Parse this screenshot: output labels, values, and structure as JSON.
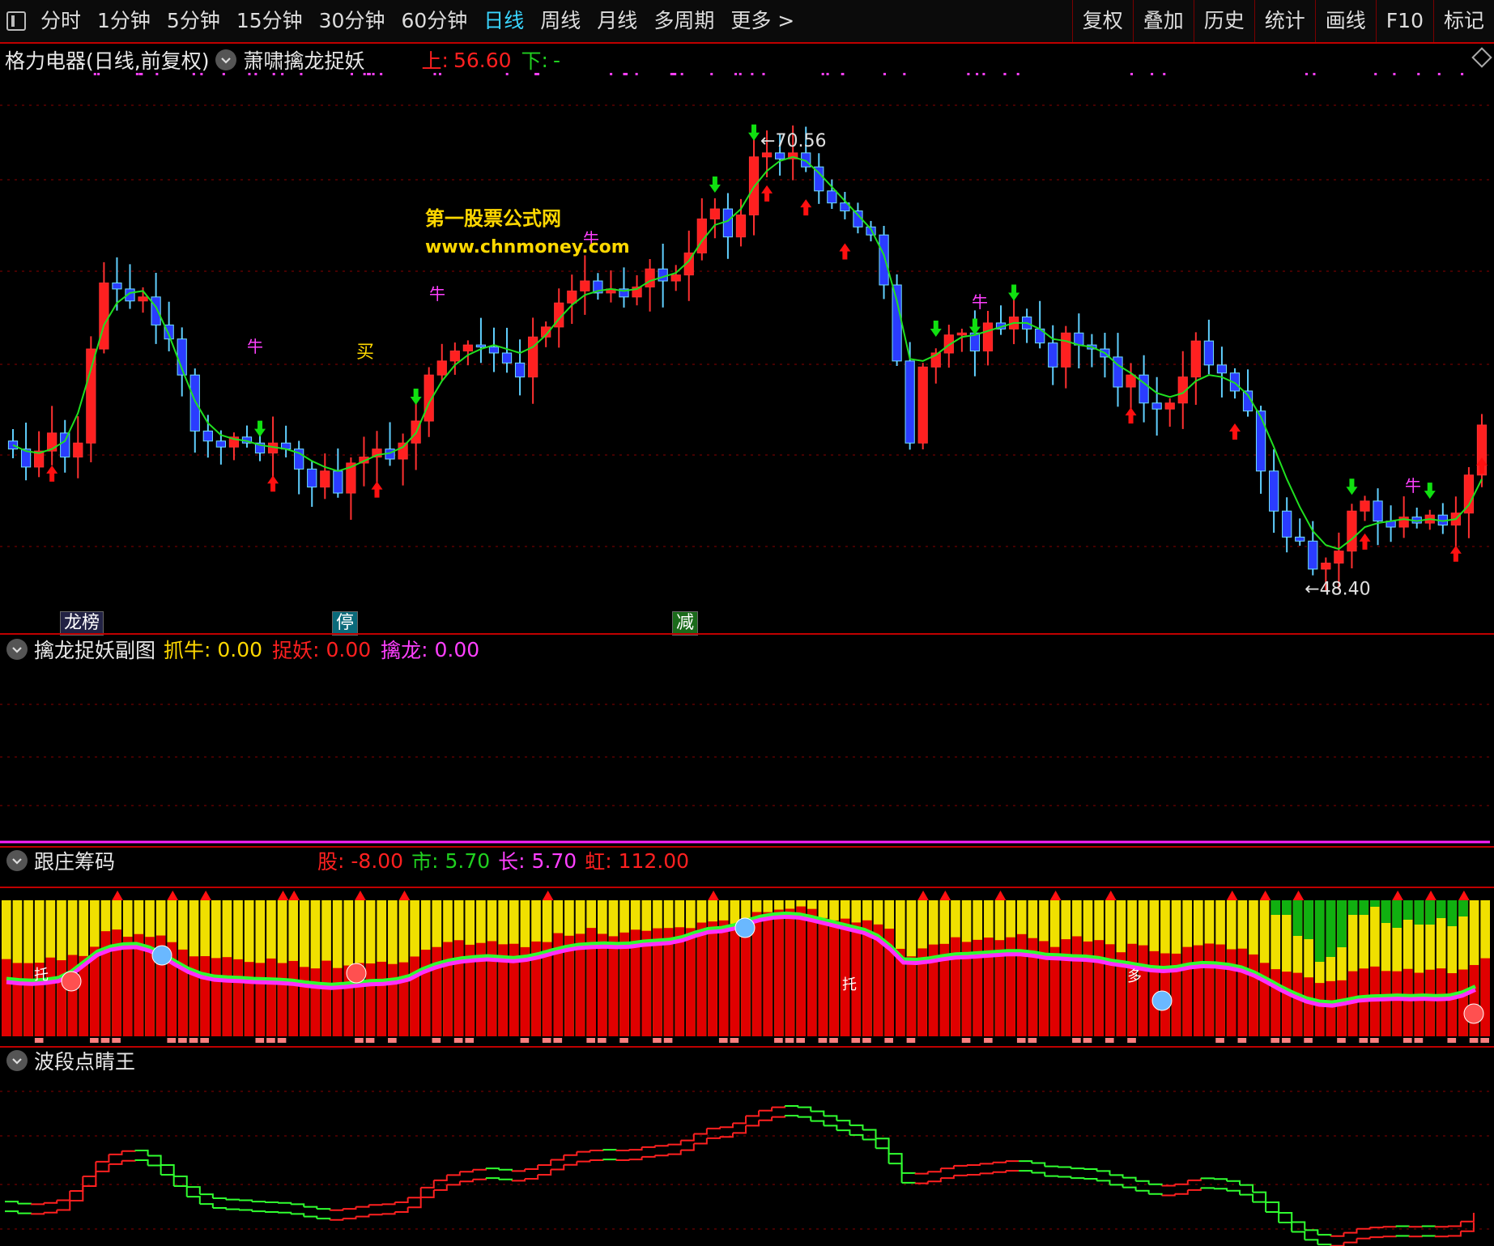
{
  "toolbar": {
    "tabs": [
      "分时",
      "1分钟",
      "5分钟",
      "15分钟",
      "30分钟",
      "60分钟",
      "日线",
      "周线",
      "月线",
      "多周期",
      "更多 >"
    ],
    "active_tab": "日线",
    "buttons": [
      "复权",
      "叠加",
      "历史",
      "统计",
      "画线",
      "F10",
      "标记"
    ]
  },
  "main": {
    "title": "格力电器(日线,前复权)",
    "indicator": "萧啸擒龙捉妖",
    "up_label": "上",
    "up_value": "56.60",
    "down_label": "下",
    "down_value": "-",
    "high_note": "70.56",
    "low_note": "48.40",
    "watermark_cn": "第一股票公式网",
    "watermark_url": "www.chnmoney.com",
    "buy_marker": "买",
    "bull_marker": "牛",
    "tags": [
      "龙榜",
      "停",
      "减"
    ]
  },
  "sub1": {
    "title": "擒龙捉妖副图",
    "items": [
      {
        "label": "抓牛",
        "value": "0.00"
      },
      {
        "label": "捉妖",
        "value": "0.00"
      },
      {
        "label": "擒龙",
        "value": "0.00"
      }
    ]
  },
  "sub2": {
    "title": "跟庄筹码",
    "items": [
      {
        "label": "股",
        "value": "-8.00"
      },
      {
        "label": "市",
        "value": "5.70"
      },
      {
        "label": "长",
        "value": "5.70"
      },
      {
        "label": "虹",
        "value": "112.00"
      }
    ],
    "marker_tuo": "托",
    "marker_duo": "多"
  },
  "sub3": {
    "title": "波段点睛王"
  },
  "chart_data": {
    "type": "candlestick",
    "ylim": [
      46,
      74
    ],
    "close": [
      55.2,
      54.3,
      55.1,
      56.0,
      54.8,
      55.5,
      60.2,
      63.5,
      63.2,
      62.6,
      62.8,
      61.4,
      60.7,
      58.9,
      56.1,
      55.6,
      55.3,
      55.8,
      55.5,
      55.0,
      55.5,
      55.2,
      54.2,
      53.3,
      54.1,
      53.0,
      54.5,
      54.8,
      55.2,
      54.7,
      55.5,
      56.6,
      58.9,
      59.6,
      60.1,
      60.4,
      60.3,
      60.0,
      59.5,
      58.8,
      60.8,
      61.3,
      62.5,
      63.1,
      63.6,
      63.0,
      63.2,
      62.8,
      63.3,
      64.2,
      63.6,
      63.9,
      65.0,
      66.7,
      67.2,
      65.8,
      66.9,
      69.8,
      70.0,
      69.7,
      70.0,
      69.3,
      68.1,
      67.5,
      67.1,
      66.3,
      65.9,
      63.4,
      59.6,
      55.5,
      59.3,
      60.0,
      60.9,
      61.0,
      60.1,
      61.5,
      61.2,
      61.8,
      61.2,
      60.5,
      59.3,
      61.0,
      60.4,
      60.2,
      59.8,
      58.3,
      58.9,
      57.5,
      57.2,
      57.5,
      58.8,
      60.6,
      59.4,
      59.0,
      58.1,
      57.1,
      54.1,
      52.1,
      50.8,
      50.6,
      49.2,
      49.5,
      50.1,
      52.1,
      52.6,
      51.6,
      51.3,
      51.8,
      51.5,
      51.9,
      51.4,
      52.0,
      53.9,
      56.4
    ],
    "ma": [
      55.4,
      55.1,
      55.0,
      55.2,
      55.6,
      57.0,
      59.2,
      61.4,
      62.5,
      63.0,
      63.1,
      62.3,
      60.9,
      59.2,
      57.6,
      56.5,
      55.9,
      55.7,
      55.6,
      55.4,
      55.3,
      55.2,
      55.0,
      54.6,
      54.3,
      54.1,
      54.3,
      54.6,
      54.9,
      55.0,
      55.3,
      56.0,
      57.5,
      58.6,
      59.4,
      59.9,
      60.2,
      60.4,
      60.2,
      60.0,
      60.3,
      60.9,
      61.7,
      62.4,
      62.9,
      63.1,
      63.2,
      63.1,
      63.2,
      63.6,
      63.8,
      64.0,
      64.6,
      65.6,
      66.4,
      66.6,
      67.2,
      68.3,
      69.1,
      69.6,
      69.8,
      69.6,
      69.0,
      68.3,
      67.6,
      66.9,
      66.2,
      64.9,
      62.6,
      59.7,
      59.6,
      59.9,
      60.4,
      60.8,
      60.9,
      61.1,
      61.3,
      61.5,
      61.5,
      61.2,
      60.7,
      60.6,
      60.4,
      60.3,
      60.0,
      59.4,
      59.0,
      58.5,
      58.0,
      57.8,
      58.0,
      58.6,
      58.9,
      58.8,
      58.5,
      57.9,
      56.8,
      55.3,
      53.7,
      52.3,
      51.1,
      50.4,
      50.2,
      50.7,
      51.3,
      51.5,
      51.6,
      51.7,
      51.6,
      51.7,
      51.6,
      51.7,
      52.4,
      53.7
    ],
    "up_value": 56.6,
    "high": 70.56,
    "low": 48.4
  }
}
